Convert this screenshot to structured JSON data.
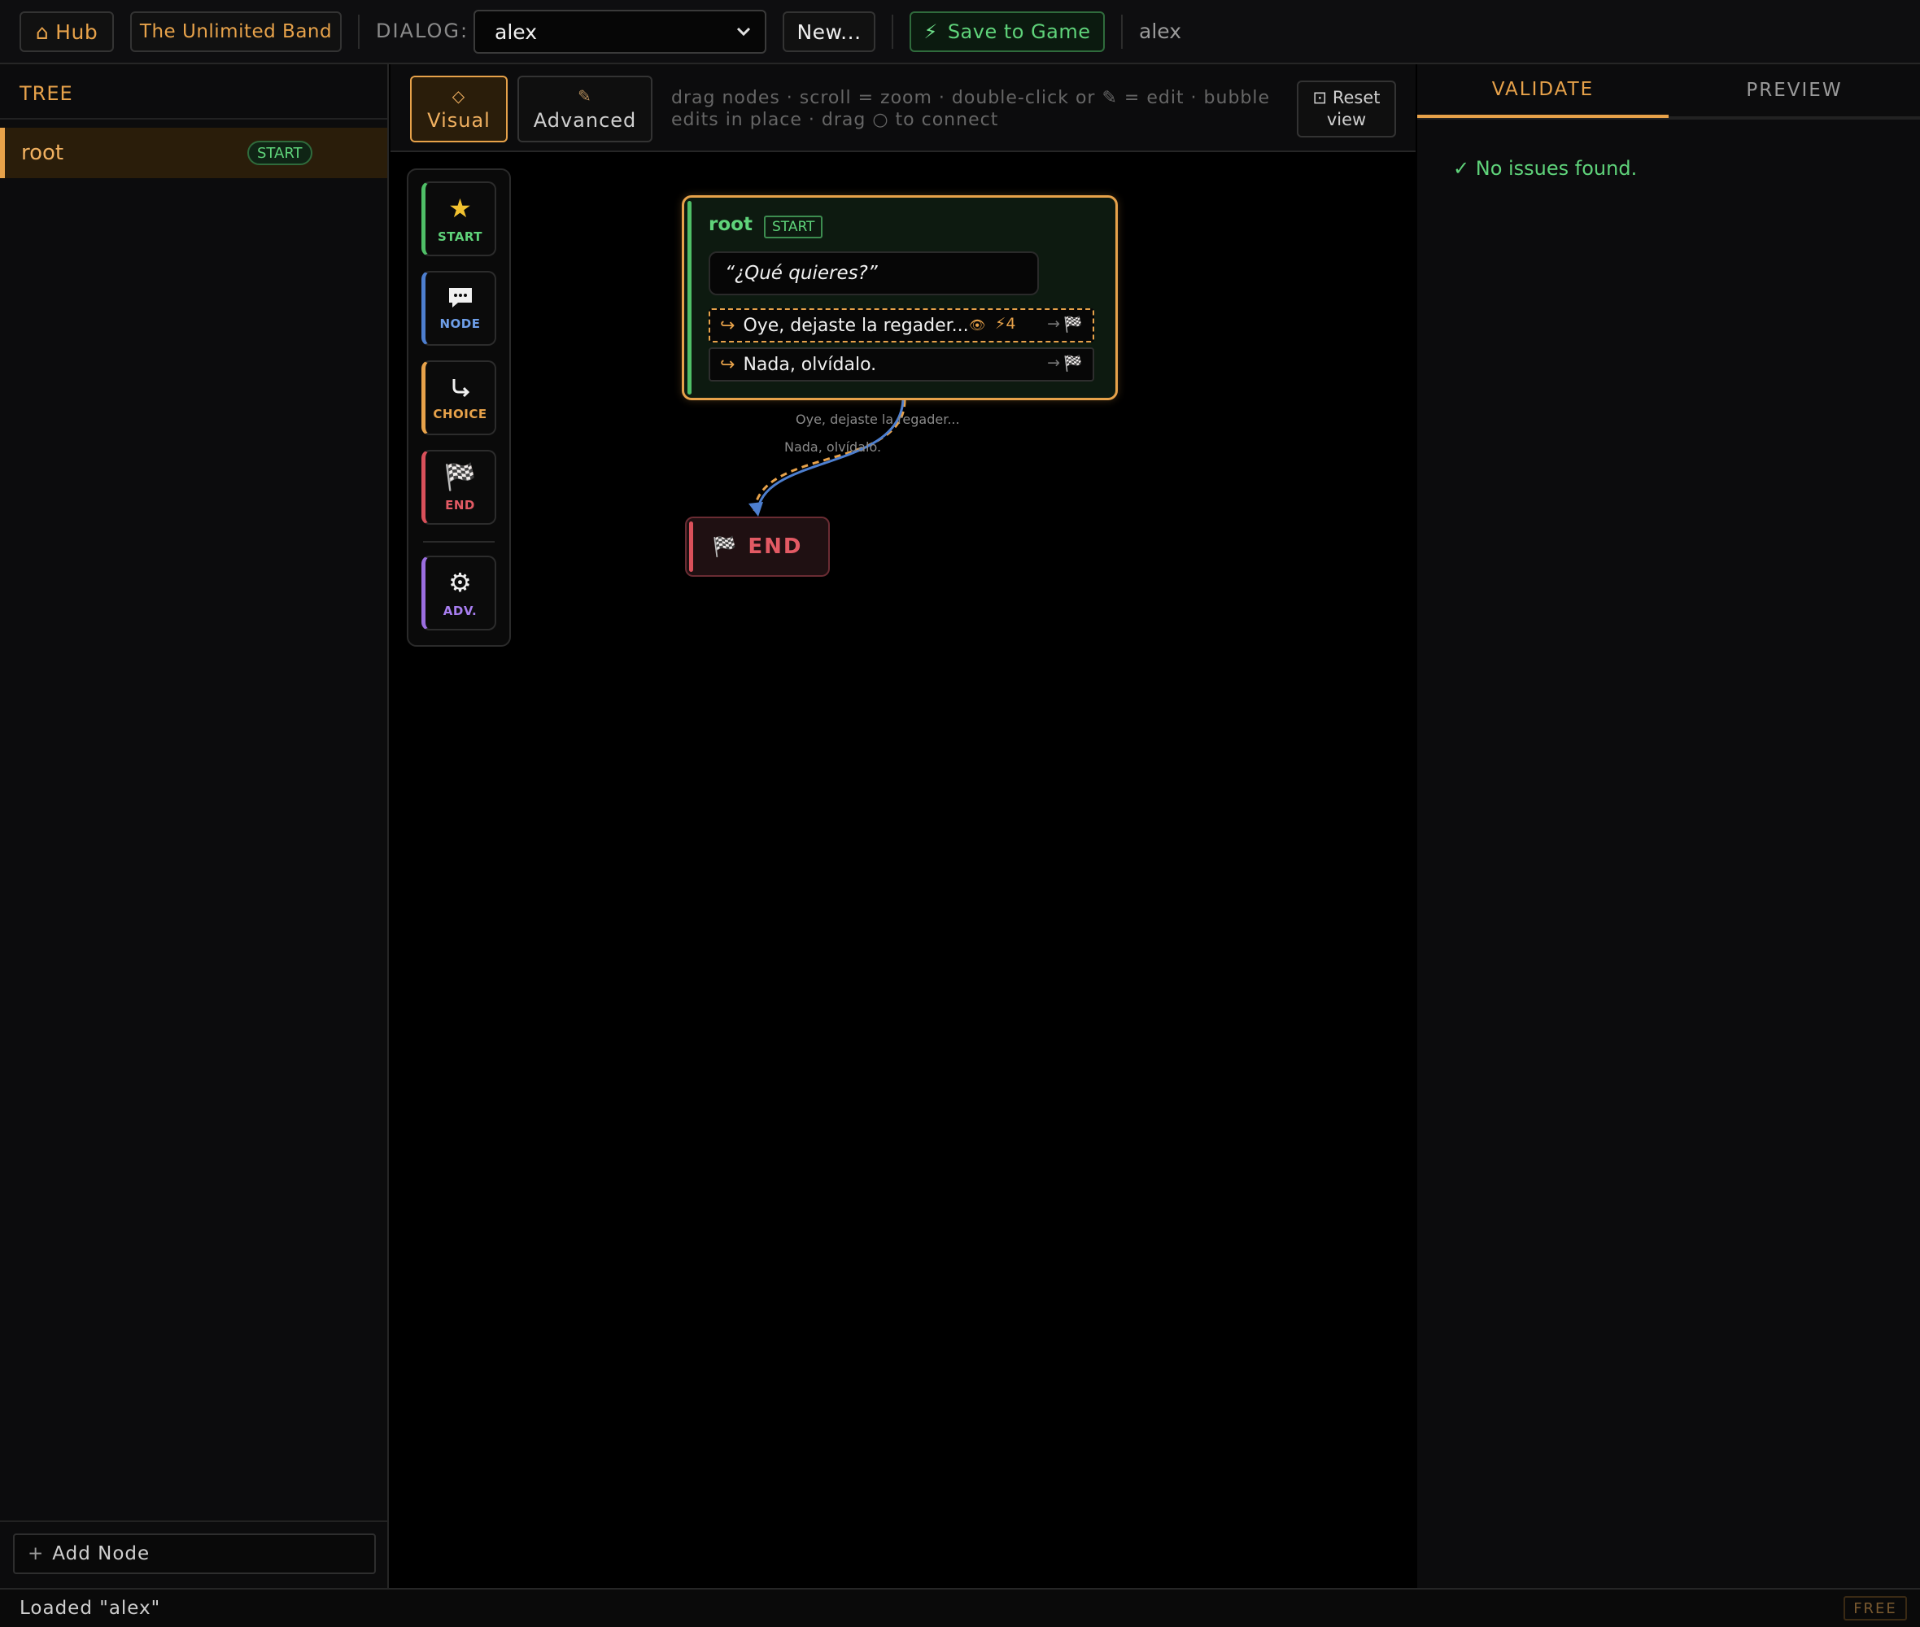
{
  "topbar": {
    "hub_label": "Hub",
    "project_label": "The Unlimited Band",
    "dialog_label": "DIALOG:",
    "dialog_selected": "alex",
    "new_label": "New...",
    "save_label": "Save to Game",
    "current_user": "alex"
  },
  "sidebar": {
    "title": "TREE",
    "items": [
      {
        "label": "root",
        "badge": "START"
      }
    ],
    "add_label": "Add Node"
  },
  "toolbar": {
    "visual_label": "Visual",
    "advanced_label": "Advanced",
    "hint": "drag nodes · scroll = zoom · double-click or ✎ = edit · bubble edits in place · drag ○ to connect",
    "reset_label": "Reset view"
  },
  "palette": {
    "items": [
      {
        "label": "START",
        "icon": "star-icon"
      },
      {
        "label": "NODE",
        "icon": "speech-bubble-icon"
      },
      {
        "label": "CHOICE",
        "icon": "branch-arrow-icon"
      },
      {
        "label": "END",
        "icon": "checkered-flag-icon"
      },
      {
        "label": "ADV.",
        "icon": "gear-icon"
      }
    ]
  },
  "graph": {
    "root": {
      "title": "root",
      "badge": "START",
      "line": "“¿Qué quieres?”",
      "choices": [
        {
          "text": "Oye, dejaste la regader...",
          "cost": "4",
          "target": "end"
        },
        {
          "text": "Nada, olvídalo.",
          "target": "end"
        }
      ]
    },
    "edge_labels": [
      "Oye, dejaste la regader...",
      "Nada, olvídalo."
    ],
    "end": {
      "label": "END"
    },
    "colors": {
      "choice_edge": "#e7a24a",
      "plain_edge": "#4d7fd0"
    }
  },
  "right_panel": {
    "tabs": [
      "VALIDATE",
      "PREVIEW"
    ],
    "message": "✓ No issues found."
  },
  "status": {
    "text": "Loaded \"alex\"",
    "badge": "FREE"
  }
}
